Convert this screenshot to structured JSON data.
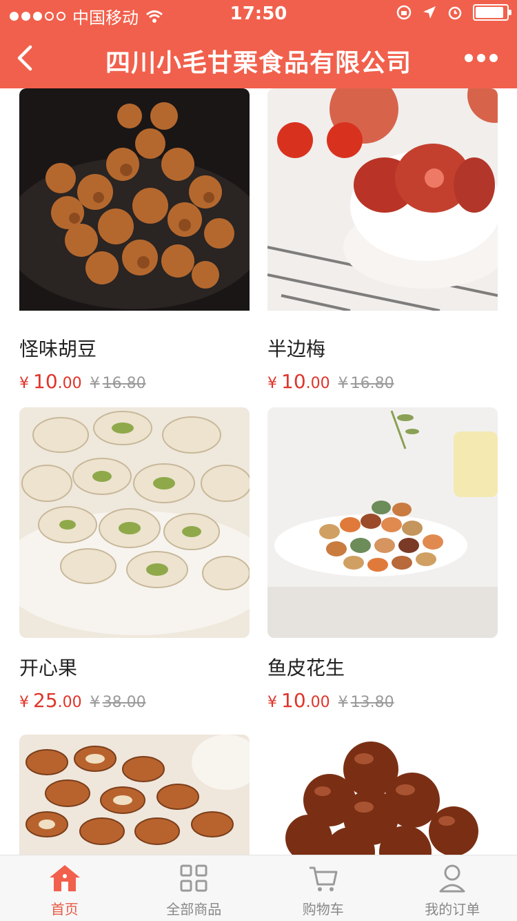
{
  "status_bar": {
    "carrier": "中国移动",
    "time": "17:50"
  },
  "nav": {
    "title": "四川小毛甘栗食品有限公司"
  },
  "products": [
    {
      "name": "怪味胡豆",
      "price_int": "10",
      "price_dec": ".00",
      "old_price": "16.80"
    },
    {
      "name": "半边梅",
      "price_int": "10",
      "price_dec": ".00",
      "old_price": "16.80"
    },
    {
      "name": "开心果",
      "price_int": "25",
      "price_dec": ".00",
      "old_price": "38.00"
    },
    {
      "name": "鱼皮花生",
      "price_int": "10",
      "price_dec": ".00",
      "old_price": "13.80"
    }
  ],
  "currency_symbol": "¥",
  "tabs": [
    {
      "label": "首页",
      "icon": "home-icon",
      "active": true
    },
    {
      "label": "全部商品",
      "icon": "grid-icon",
      "active": false
    },
    {
      "label": "购物车",
      "icon": "cart-icon",
      "active": false
    },
    {
      "label": "我的订单",
      "icon": "user-icon",
      "active": false
    }
  ],
  "colors": {
    "brand": "#f1604c",
    "price": "#e0342a",
    "tab_active": "#e65a45"
  }
}
